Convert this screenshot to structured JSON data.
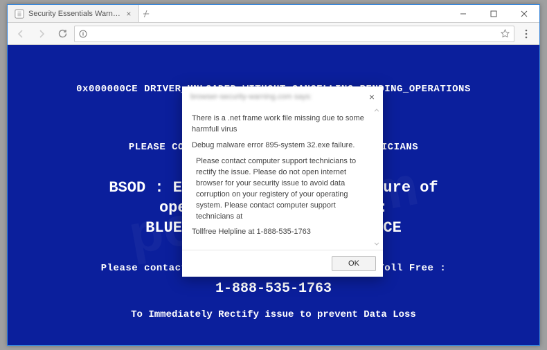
{
  "window": {
    "tab_title": "Security Essentials Warn…",
    "controls": {
      "minimize": "−",
      "maximize": "□",
      "close": "✕"
    }
  },
  "toolbar": {
    "url": ""
  },
  "bsod": {
    "err_line": "0x000000CE DRIVER_UNLOADED_WITHOUT_CANCELLING_PENDING_OPERATIONS",
    "please_line": "PLEASE CONTACT OUR COMPUTER SUPPORT TECHNICIANS",
    "big1": "BSOD : Error 333 Registry Failure of",
    "big2": "operating system - Host :",
    "big3": "BLUE SCREEN ERROR 0x000000CE",
    "contact": "Please contact computer support technicians, Toll Free :",
    "phone": "1-888-535-1763",
    "footer": "To Immediately Rectify issue to prevent Data Loss"
  },
  "dialog": {
    "title_blurred": "browser-security-warning.com says:",
    "p1": "There is a .net frame work file missing due to some harmfull virus",
    "p2": "Debug malware error 895-system 32.exe failure.",
    "p3": "Please contact computer support technicians to rectify the issue. Please do not open internet browser for your security issue to avoid data corruption on your registery of your operating system. Please contact computer support technicians at",
    "p4": "Tollfree Helpline at 1-888-535-1763",
    "ok_label": "OK"
  }
}
